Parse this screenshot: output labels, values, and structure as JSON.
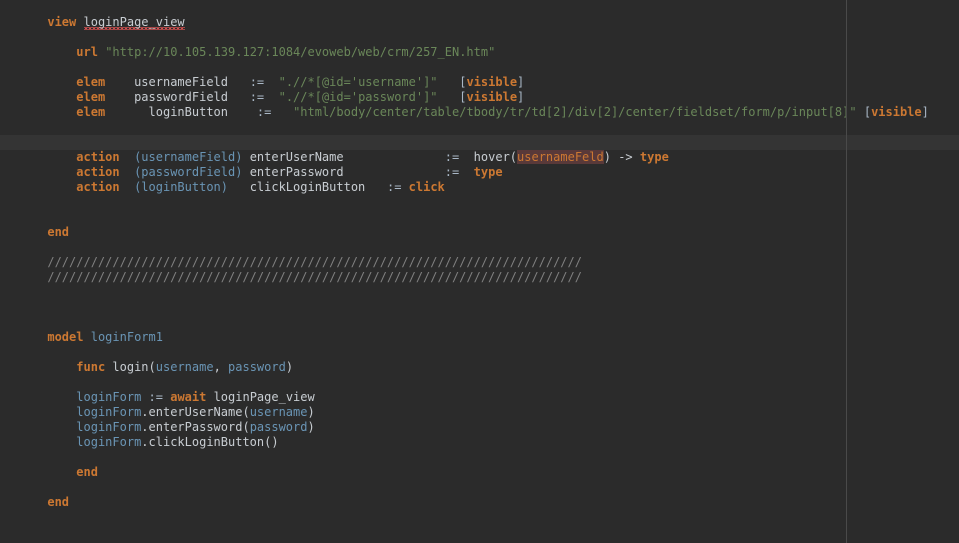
{
  "editor": {
    "background_color": "#2b2b2b",
    "current_line_highlight_color": "#343434",
    "ruler_color": "#4a4a4a",
    "keyword_color": "#cc7832",
    "string_color": "#6a8759",
    "identifier_color": "#a9b7c6",
    "parameter_color": "#6a95b5",
    "comment_color": "#808080",
    "error_highlight_color": "#593939"
  },
  "code": {
    "view_keyword": "view",
    "view_name": "loginPage_view",
    "url_keyword": "url",
    "url_open_quote": "\"",
    "url_value": "http://10.105.139.127:1084/evoweb/web/crm/257_EN.htm",
    "url_close_quote": "\"",
    "elem_keyword": "elem",
    "assign_op": ":=",
    "elem1_name": "usernameField",
    "elem1_locator": "\".//*[@id='username']\"",
    "elem1_flag_open": "[",
    "elem1_flag": "visible",
    "elem1_flag_close": "]",
    "elem2_name": "passwordField",
    "elem2_locator": "\".//*[@id='password']\"",
    "elem2_flag_open": "[",
    "elem2_flag": "visible",
    "elem2_flag_close": "]",
    "elem3_name": "loginButton",
    "elem3_locator": "\"html/body/center/table/tbody/tr/td[2]/div[2]/center/fieldset/form/p/input[8]\"",
    "elem3_flag_open": "[",
    "elem3_flag": "visible",
    "elem3_flag_close": "]",
    "action_keyword": "action",
    "action1_target": "(usernameField)",
    "action1_name": "enterUserName",
    "action1_body_fn": "hover",
    "action1_body_open": "(",
    "action1_body_arg": "usernameFeld",
    "action1_body_close": ")",
    "action1_arrow": "->",
    "action1_body_kw": "type",
    "action2_target": "(passwordField)",
    "action2_name": "enterPassword",
    "action2_body_kw": "type",
    "action3_target": "(loginButton)",
    "action3_name": "clickLoginButton",
    "action3_body_kw": "click",
    "end_keyword": "end",
    "comment_line_1": "//////////////////////////////////////////////////////////////////////////",
    "comment_line_2": "//////////////////////////////////////////////////////////////////////////",
    "model_keyword": "model",
    "model_name": "loginForm1",
    "func_keyword": "func",
    "func_name": "login",
    "func_paren_open": "(",
    "func_param1": "username",
    "func_param_sep": ", ",
    "func_param2": "password",
    "func_paren_close": ")",
    "stmt1_var": "loginForm",
    "stmt1_assign": ":=",
    "stmt1_await": "await",
    "stmt1_value": "loginPage_view",
    "stmt2_var": "loginForm",
    "stmt2_dot": ".",
    "stmt2_method": "enterUserName",
    "stmt2_open": "(",
    "stmt2_arg": "username",
    "stmt2_close": ")",
    "stmt3_var": "loginForm",
    "stmt3_dot": ".",
    "stmt3_method": "enterPassword",
    "stmt3_open": "(",
    "stmt3_arg": "password",
    "stmt3_close": ")",
    "stmt4_var": "loginForm",
    "stmt4_dot": ".",
    "stmt4_method": "clickLoginButton",
    "stmt4_open": "(",
    "stmt4_close": ")",
    "end_func_keyword": "end",
    "end_model_keyword": "end"
  }
}
